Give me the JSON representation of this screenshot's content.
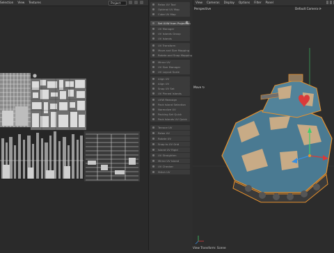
{
  "topbar": {
    "left_menu": [
      "Selection",
      "View",
      "Textures"
    ],
    "project_select": "Project",
    "right_menu": [
      "View",
      "Cameras",
      "Display",
      "Options",
      "Filter",
      "Panel"
    ]
  },
  "uv_editor": {},
  "uv_tools": {
    "items": [
      {
        "label": "Relax UV Tool"
      },
      {
        "label": "Optimal UV Map"
      },
      {
        "label": "Cube UV Map"
      },
      {
        "label": "Set UVW from Projection"
      },
      {
        "label": "UV Manager"
      },
      {
        "label": "UV Islands Group"
      },
      {
        "label": "UV Islands"
      },
      {
        "label": "UV Transform"
      },
      {
        "label": "Move and Size Mapping"
      },
      {
        "label": "Rotate and Snap Mapping"
      },
      {
        "label": "Mirror UV"
      },
      {
        "label": "UV Size Manager"
      },
      {
        "label": "UV Layout Scale"
      },
      {
        "label": "Align UV"
      },
      {
        "label": "Align UV"
      },
      {
        "label": "Snap UV Set"
      },
      {
        "label": "UV Pinned Islands"
      },
      {
        "label": "UVW Reassign"
      },
      {
        "label": "Pack Island Selection"
      },
      {
        "label": "Normalize UV"
      },
      {
        "label": "Packing Set Quick"
      },
      {
        "label": "Pack Islands UV Quick"
      },
      {
        "label": "Terrace UV"
      },
      {
        "label": "Relax UV"
      },
      {
        "label": "Rotate UV"
      },
      {
        "label": "Snap to UV Grid"
      },
      {
        "label": "Island UV Rigid"
      },
      {
        "label": "UV Straighten"
      },
      {
        "label": "Mirror UV Island"
      },
      {
        "label": "UV Checker"
      },
      {
        "label": "Stitch UV"
      }
    ]
  },
  "viewport": {
    "label": "Perspective",
    "camera": "Default Camera",
    "move_label": "Move",
    "status": "View Transform: Scene"
  },
  "colors": {
    "accent_orange": "#e8922e",
    "axis_green": "#3fcf6a",
    "axis_blue": "#3a8fe0",
    "axis_red": "#d93a3a",
    "tank_blue": "#4a7a92",
    "tank_tan": "#c8ab86"
  }
}
